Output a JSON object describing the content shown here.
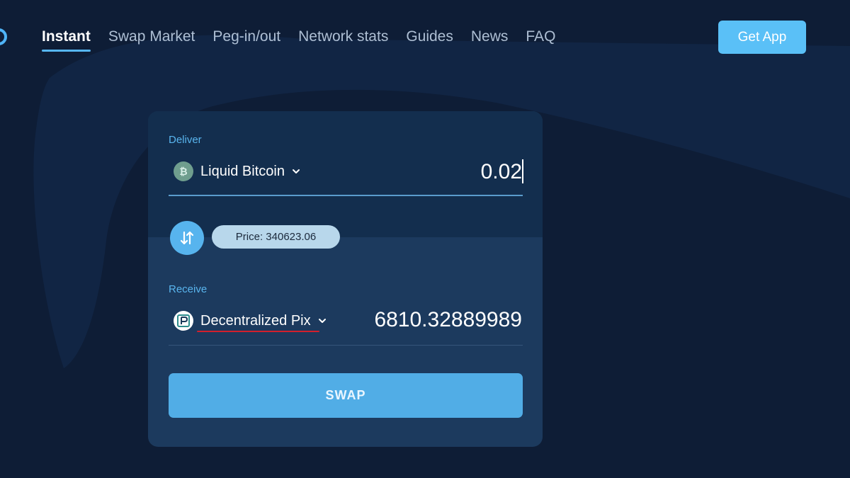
{
  "nav": {
    "items": [
      {
        "label": "Instant",
        "active": true
      },
      {
        "label": "Swap Market",
        "active": false
      },
      {
        "label": "Peg-in/out",
        "active": false
      },
      {
        "label": "Network stats",
        "active": false
      },
      {
        "label": "Guides",
        "active": false
      },
      {
        "label": "News",
        "active": false
      },
      {
        "label": "FAQ",
        "active": false
      }
    ],
    "get_app_label": "Get App"
  },
  "swap": {
    "deliver": {
      "label": "Deliver",
      "asset": "Liquid Bitcoin",
      "asset_icon": "bitcoin-icon",
      "amount": "0.02"
    },
    "price_text": "Price: 340623.06",
    "receive": {
      "label": "Receive",
      "asset": "Decentralized Pix",
      "asset_icon": "pix-logo-icon",
      "amount": "6810.32889989"
    },
    "swap_label": "SWAP"
  },
  "colors": {
    "accent": "#56b6f2",
    "background": "#0e1d36",
    "card": "#1c3a5e",
    "card_top": "#132e4e",
    "annotation_underline": "#d2202c"
  }
}
